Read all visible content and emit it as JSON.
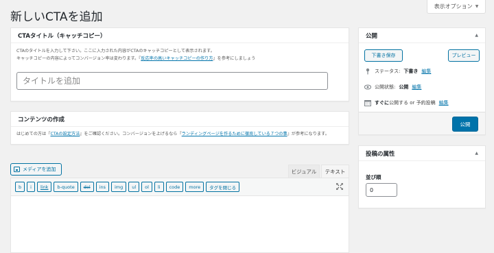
{
  "page": {
    "title": "新しいCTAを追加",
    "screen_options": "表示オプション"
  },
  "cta_title_box": {
    "heading": "CTAタイトル（キャッチコピー）",
    "desc_line1": "CTAのタイトルを入力して下さい。ここに入力された内容がCTAのキャッチコピーとして表示されます。",
    "desc_line2_pre": "キャッチコピーの内容によってコンバージョン率は変わります。『",
    "desc_line2_link": "反応率の高いキャッチコピーの作り方",
    "desc_line2_post": "』を参考にしましょう",
    "input_placeholder": "タイトルを追加",
    "input_value": ""
  },
  "content_box": {
    "heading": "コンテンツの作成",
    "desc_pre": "はじめての方は『",
    "desc_link1": "CTAの設定方法",
    "desc_mid": "』をご確認ください。コンバージョンを上げるなら『",
    "desc_link2": "ランディングページを作るために徹底している７つの事",
    "desc_post": "』が参考になります。"
  },
  "editor": {
    "media_button": "メディアを追加",
    "tab_visual": "ビジュアル",
    "tab_text": "テキスト",
    "quicktags": [
      "b",
      "i",
      "link",
      "b-quote",
      "del",
      "ins",
      "img",
      "ul",
      "ol",
      "li",
      "code",
      "more",
      "タグを閉じる"
    ]
  },
  "publish": {
    "heading": "公開",
    "save_draft": "下書き保存",
    "preview": "プレビュー",
    "status_label": "ステータス:",
    "status_value": "下書き",
    "status_edit": "編集",
    "visibility_label": "公開状態:",
    "visibility_value": "公開",
    "visibility_edit": "編集",
    "schedule_label_bold": "すぐに",
    "schedule_label_rest": "公開する or 予約投稿",
    "schedule_edit": "編集",
    "publish_button": "公開"
  },
  "attributes": {
    "heading": "投稿の属性",
    "order_label": "並び順",
    "order_value": "0"
  },
  "colors": {
    "accent": "#0073aa",
    "background": "#f1f1f1"
  }
}
